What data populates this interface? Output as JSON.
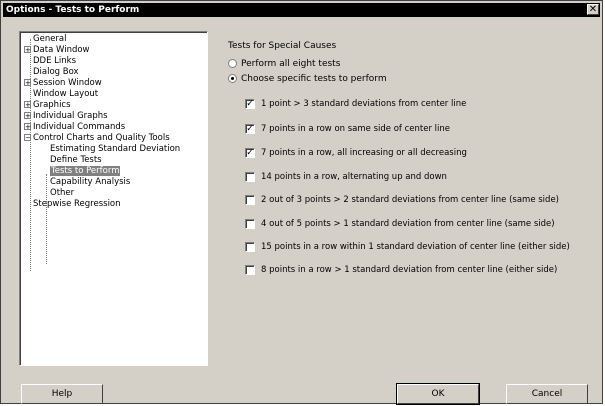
{
  "window": {
    "title": "Options - Tests to Perform",
    "close_glyph": "✕"
  },
  "tree": {
    "items": [
      {
        "label": "General"
      },
      {
        "label": "Data Window",
        "expander": "+"
      },
      {
        "label": "DDE Links"
      },
      {
        "label": "Dialog Box"
      },
      {
        "label": "Session Window",
        "expander": "+"
      },
      {
        "label": "Window Layout"
      },
      {
        "label": "Graphics",
        "expander": "+"
      },
      {
        "label": "Individual Graphs",
        "expander": "+"
      },
      {
        "label": "Individual Commands",
        "expander": "+"
      },
      {
        "label": "Control Charts and Quality Tools",
        "expander": "−"
      },
      {
        "label": "Estimating Standard Deviation"
      },
      {
        "label": "Define Tests"
      },
      {
        "label": "Tests to Perform"
      },
      {
        "label": "Capability Analysis"
      },
      {
        "label": "Other"
      },
      {
        "label": "Stepwise Regression"
      }
    ]
  },
  "panel": {
    "group_title": "Tests for Special Causes",
    "radios": [
      {
        "label": "Perform all eight tests",
        "selected": false
      },
      {
        "label": "Choose specific tests to perform",
        "selected": true
      }
    ],
    "tests": [
      {
        "label": "1 point > 3 standard deviations from center line",
        "checked": true
      },
      {
        "label": "7 points in a row on same side of center line",
        "checked": true
      },
      {
        "label": "7 points in a row, all increasing or all decreasing",
        "checked": true
      },
      {
        "label": "14 points in a row, alternating up and down",
        "checked": false
      },
      {
        "label": "2 out of 3 points > 2 standard deviations from center line (same side)",
        "checked": false
      },
      {
        "label": "4 out of 5 points > 1 standard deviation from center line (same side)",
        "checked": false
      },
      {
        "label": "15 points in a row within 1 standard deviation of center line (either side)",
        "checked": false
      },
      {
        "label": "8 points in a row > 1 standard deviation from center line (either side)",
        "checked": false
      }
    ],
    "check_glyph": "✓"
  },
  "buttons": {
    "help": "Help",
    "ok": "OK",
    "cancel": "Cancel"
  }
}
